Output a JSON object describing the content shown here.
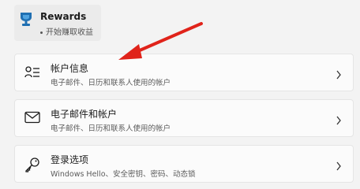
{
  "rewards": {
    "title": "Rewards",
    "subtitle": "开始赚取收益"
  },
  "items": [
    {
      "title": "帐户信息",
      "description": "电子邮件、日历和联系人使用的帐户",
      "icon": "account-info-icon"
    },
    {
      "title": "电子邮件和帐户",
      "description": "电子邮件、日历和联系人使用的帐户",
      "icon": "mail-icon"
    },
    {
      "title": "登录选项",
      "description": "Windows Hello、安全密钥、密码、动态锁",
      "icon": "key-icon"
    }
  ],
  "colors": {
    "accent": "#1f6fb2",
    "annotation_arrow": "#e0231a"
  }
}
